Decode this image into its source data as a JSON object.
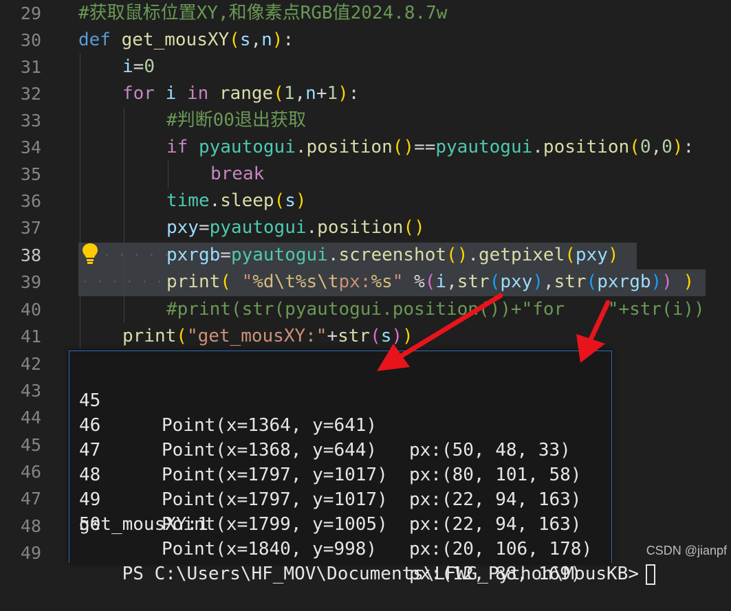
{
  "editor": {
    "active_line": "38",
    "lines": [
      {
        "no": "29",
        "text": "#获取鼠标位置XY,和像素点RGB值2024.8.7w"
      },
      {
        "no": "30",
        "text": "def get_mousXY(s,n):"
      },
      {
        "no": "31",
        "text": "i=0"
      },
      {
        "no": "32",
        "text": "for i in range(1,n+1):"
      },
      {
        "no": "33",
        "text": "#判断00退出获取"
      },
      {
        "no": "34",
        "text": "if pyautogui.position()==pyautogui.position(0,0):"
      },
      {
        "no": "35",
        "text": "break"
      },
      {
        "no": "36",
        "text": "time.sleep(s)"
      },
      {
        "no": "37",
        "text": "pxy=pyautogui.position()"
      },
      {
        "no": "38",
        "text": "pxrgb=pyautogui.screenshot().getpixel(pxy)"
      },
      {
        "no": "39",
        "text": "print( \"%d\\t%s\\tpx:%s\" %(i,str(pxy),str(pxrgb)) )"
      },
      {
        "no": "40",
        "text": "#print(str(pyautogui.position())+\"for    \"+str(i))"
      },
      {
        "no": "41",
        "text": "print(\"get_mousXY:\"+str(s))"
      },
      {
        "no": "42",
        "text": ""
      },
      {
        "no": "43",
        "text": ""
      },
      {
        "no": "44",
        "text": ""
      },
      {
        "no": "45",
        "text": ""
      },
      {
        "no": "46",
        "text": ""
      },
      {
        "no": "47",
        "text": ""
      },
      {
        "no": "48",
        "text": ""
      },
      {
        "no": "49",
        "text": ""
      }
    ],
    "lightbulb_icon": "lightbulb-icon"
  },
  "terminal": {
    "rows": [
      {
        "i": "45",
        "point": "Point(x=1364, y=641)",
        "px": "px:(50, 48, 33)"
      },
      {
        "i": "46",
        "point": "Point(x=1368, y=644)",
        "px": "px:(80, 101, 58)"
      },
      {
        "i": "47",
        "point": "Point(x=1797, y=1017)",
        "px": "px:(22, 94, 163)"
      },
      {
        "i": "48",
        "point": "Point(x=1797, y=1017)",
        "px": "px:(22, 94, 163)"
      },
      {
        "i": "49",
        "point": "Point(x=1799, y=1005)",
        "px": "px:(20, 106, 178)"
      },
      {
        "i": "50",
        "point": "Point(x=1840, y=998)",
        "px": "px:(12, 88, 169)"
      }
    ],
    "summary": "get_mousXY:1",
    "prompt": "PS C:\\Users\\HF_MOV\\Documents\\LFWG_Python\\MousKB>"
  },
  "annotation_color": "#e8141c",
  "watermark": "CSDN @jianpf"
}
